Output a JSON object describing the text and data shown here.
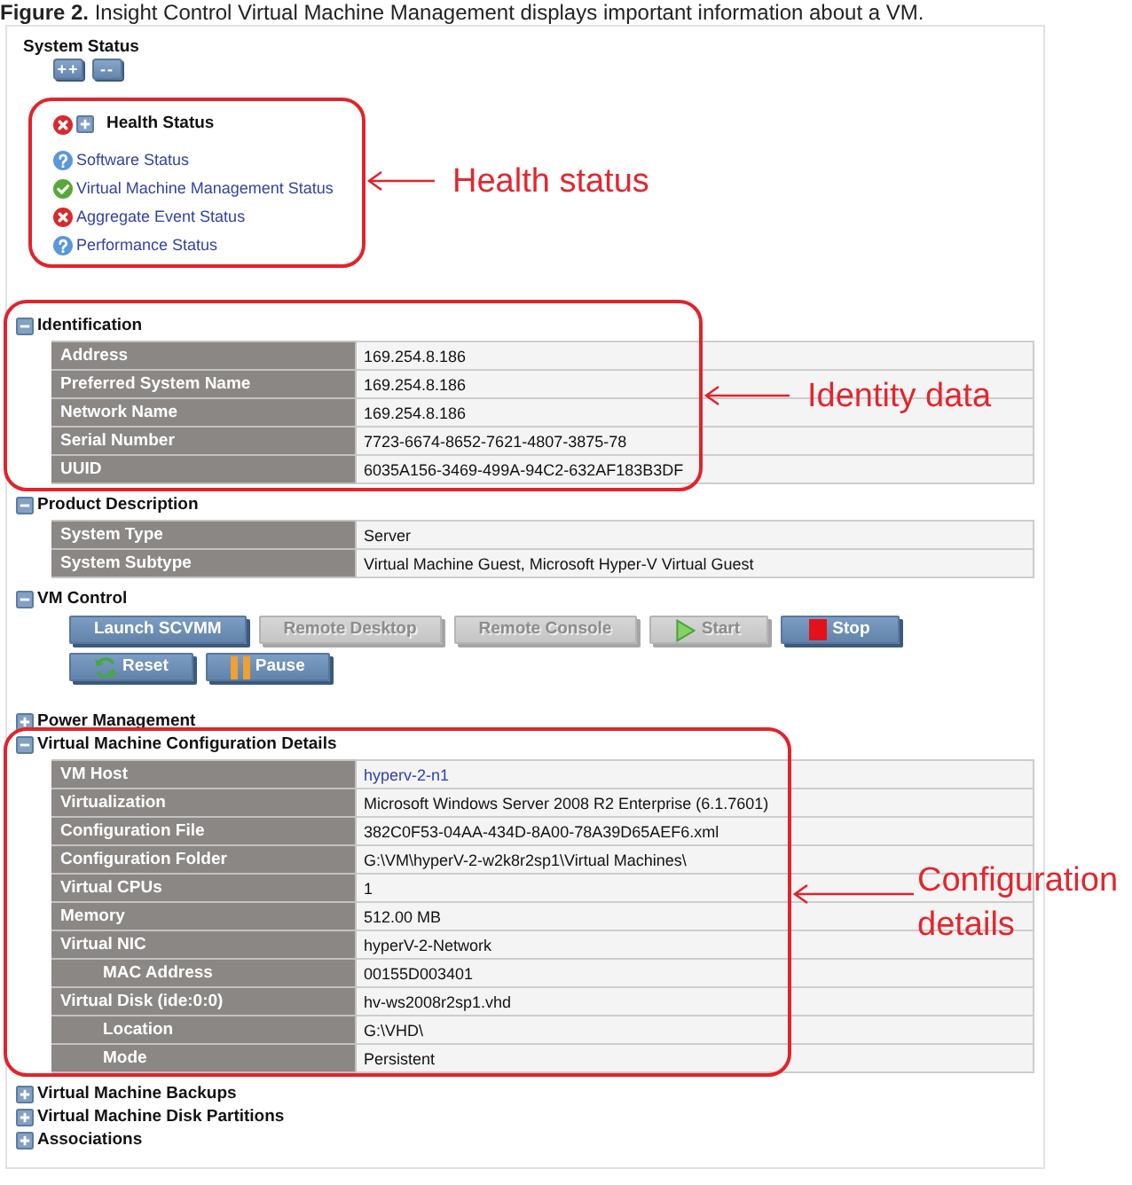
{
  "caption": "**Figure 2.** Insight Control Virtual Machine Management displays important information about a VM.",
  "system_status": {
    "title": "System Status",
    "toolbar": [
      {
        "label": "++"
      },
      {
        "label": "--"
      }
    ],
    "health": {
      "title": "Health Status",
      "kind": "critical",
      "expanded": false,
      "items": [
        {
          "label": "Software Status",
          "kind": "unknown"
        },
        {
          "label": "Virtual Machine Management Status",
          "kind": "ok"
        },
        {
          "label": "Aggregate Event Status",
          "kind": "critical"
        },
        {
          "label": "Performance Status",
          "kind": "unknown"
        }
      ]
    }
  },
  "sections": [
    {
      "title": "Identification",
      "expanded": true,
      "kind": "table",
      "rows": [
        {
          "label": "Address",
          "value": "169.254.8.186",
          "link": false
        },
        {
          "label": "Preferred System Name",
          "value": "169.254.8.186",
          "link": false
        },
        {
          "label": "Network Name",
          "value": "169.254.8.186",
          "link": false
        },
        {
          "label": "Serial Number",
          "value": "7723-6674-8652-7621-4807-3875-78",
          "link": false
        },
        {
          "label": "UUID",
          "value": "6035A156-3469-499A-94C2-632AF183B3DF",
          "link": false
        }
      ]
    },
    {
      "title": "Product Description",
      "expanded": true,
      "kind": "table",
      "rows": [
        {
          "label": "System Type",
          "value": "Server",
          "link": false
        },
        {
          "label": "System Subtype",
          "value": "Virtual Machine Guest, Microsoft Hyper-V Virtual Guest",
          "link": false
        }
      ]
    },
    {
      "title": "VM Control",
      "expanded": true,
      "kind": "buttons",
      "button_rows": [
        [
          {
            "label": "Launch SCVMM",
            "kind": "plain",
            "disabled": false
          },
          {
            "label": "Remote Desktop",
            "kind": "plain",
            "disabled": true
          },
          {
            "label": "Remote Console",
            "kind": "plain",
            "disabled": true
          },
          {
            "label": "Start",
            "kind": "start",
            "disabled": true
          },
          {
            "label": "Stop",
            "kind": "stop",
            "disabled": false
          }
        ],
        [
          {
            "label": "Reset",
            "kind": "reset",
            "disabled": false
          },
          {
            "label": "Pause",
            "kind": "pause",
            "disabled": false
          }
        ]
      ]
    },
    {
      "title": "Power Management",
      "expanded": false
    },
    {
      "title": "Virtual Machine Configuration Details",
      "expanded": true,
      "kind": "table",
      "rows": [
        {
          "label": "VM Host",
          "value": "hyperv-2-n1",
          "link": true
        },
        {
          "label": "Virtualization",
          "value": "Microsoft Windows Server 2008 R2 Enterprise (6.1.7601)",
          "link": false
        },
        {
          "label": "Configuration File",
          "value": "382C0F53-04AA-434D-8A00-78A39D65AEF6.xml",
          "link": false
        },
        {
          "label": "Configuration Folder",
          "value": "G:\\VM\\hyperV-2-w2k8r2sp1\\Virtual Machines\\",
          "link": false
        },
        {
          "label": "Virtual CPUs",
          "value": "1",
          "link": false
        },
        {
          "label": "Memory",
          "value": "512.00 MB",
          "link": false
        },
        {
          "label": "Virtual NIC",
          "value": "hyperV-2-Network",
          "link": false,
          "children": [
            {
              "label": "MAC Address",
              "value": "00155D003401",
              "link": false
            }
          ]
        },
        {
          "label": "Virtual Disk (ide:0:0)",
          "value": "hv-ws2008r2sp1.vhd",
          "link": false,
          "children": [
            {
              "label": "Location",
              "value": "G:\\VHD\\",
              "link": false
            },
            {
              "label": "Mode",
              "value": "Persistent",
              "link": false
            }
          ]
        }
      ]
    },
    {
      "title": "Virtual Machine Backups",
      "expanded": false
    },
    {
      "title": "Virtual Machine Disk Partitions",
      "expanded": false
    },
    {
      "title": "Associations",
      "expanded": false
    }
  ],
  "annotations": [
    {
      "label": "Health status"
    },
    {
      "label": "Identity data"
    },
    {
      "label": "Configuration details"
    }
  ]
}
